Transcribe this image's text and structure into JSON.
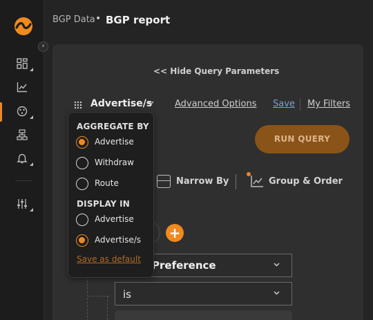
{
  "sidebar": {
    "icons": [
      "app-logo",
      "dashboard-icon",
      "chart-icon",
      "globe-network-icon",
      "sitemap-icon",
      "bell-icon",
      "settings-sliders-icon"
    ],
    "collapse_glyph": "›",
    "accent": "#e8862b"
  },
  "header": {
    "breadcrumb_parent": "BGP Data",
    "separator": "•",
    "breadcrumb_current": "BGP report",
    "chevron": "⌄"
  },
  "query": {
    "hide_params_label": "<< Hide Query Parameters",
    "aggregate_selected": "Advertise/s",
    "advanced_options_label": "Advanced Options",
    "save_label": "Save",
    "my_filters_label": "My Filters",
    "run_query_label": "RUN QUERY",
    "narrow_by_label": "Narrow By",
    "group_order_label": "Group & Order",
    "add_glyph": "+",
    "field_value": "Preference",
    "operator_value": "is",
    "chevron": "⌄"
  },
  "aggregate_dropdown": {
    "aggregate_heading": "AGGREGATE BY",
    "aggregate_options": [
      {
        "label": "Advertise",
        "checked": true
      },
      {
        "label": "Withdraw",
        "checked": false
      },
      {
        "label": "Route",
        "checked": false
      }
    ],
    "display_heading": "DISPLAY IN",
    "display_options": [
      {
        "label": "Advertise",
        "checked": false
      },
      {
        "label": "Advertise/s",
        "checked": true
      }
    ],
    "save_default_label": "Save as default"
  },
  "colors": {
    "accent": "#f08a1e",
    "run_button": "#8a5418",
    "save_link": "#7aa3d8"
  }
}
